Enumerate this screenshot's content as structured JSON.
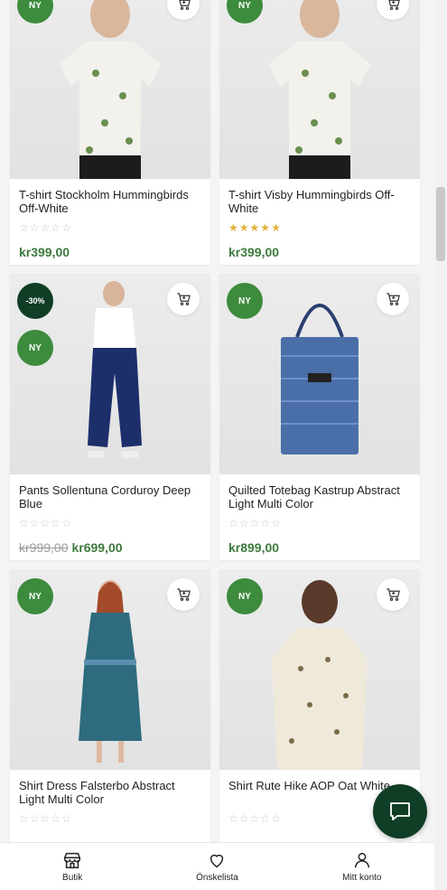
{
  "products": [
    {
      "title": "T-shirt Stockholm Hummingbirds Off-White",
      "badges": [
        "NY"
      ],
      "rating_stars": 0,
      "price": "kr399,00",
      "old_price": "",
      "garment": "tee",
      "palette": "light"
    },
    {
      "title": "T-shirt Visby Hummingbirds Off-White",
      "badges": [
        "NY"
      ],
      "rating_stars": 5,
      "price": "kr399,00",
      "old_price": "",
      "garment": "tee",
      "palette": "light"
    },
    {
      "title": "Pants Sollentuna Corduroy Deep Blue",
      "badges": [
        "-30%",
        "NY"
      ],
      "rating_stars": 0,
      "price": "kr699,00",
      "old_price": "kr999,00",
      "garment": "pants",
      "palette": "navy"
    },
    {
      "title": "Quilted Totebag Kastrup Abstract Light Multi Color",
      "badges": [
        "NY"
      ],
      "rating_stars": 0,
      "price": "kr899,00",
      "old_price": "",
      "garment": "bag",
      "palette": "blue"
    },
    {
      "title": "Shirt Dress Falsterbo Abstract Light Multi Color",
      "badges": [
        "NY"
      ],
      "rating_stars": 0,
      "price": "",
      "old_price": "",
      "garment": "dress",
      "palette": "teal"
    },
    {
      "title": "Shirt Rute Hike AOP Oat White",
      "badges": [
        "NY"
      ],
      "rating_stars": 0,
      "price": "",
      "old_price": "",
      "garment": "shirt",
      "palette": "oat"
    }
  ],
  "bottom_nav": [
    {
      "label": "Butik",
      "icon": "store-icon"
    },
    {
      "label": "Önskelista",
      "icon": "heart-icon"
    },
    {
      "label": "Mitt konto",
      "icon": "user-icon"
    }
  ],
  "chat": {
    "icon": "chat-bubble-icon"
  },
  "colors": {
    "new_badge": "#3d8b3d",
    "sale_badge": "#0f3d25",
    "price": "#3d7a3d",
    "star": "#e2b13c"
  }
}
